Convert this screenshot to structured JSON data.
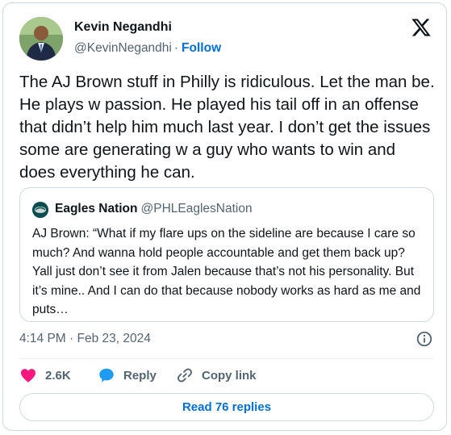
{
  "author": {
    "name": "Kevin Negandhi",
    "handle": "@KevinNegandhi",
    "separator": "·",
    "follow_label": "Follow"
  },
  "tweet": {
    "text": "The AJ Brown stuff in Philly is  ridiculous. Let the man be. He plays w passion. He played his tail off in an offense that didn’t help him much last year. I don’t get the issues some are generating w a guy who wants to win and does everything he can.",
    "timestamp": "4:14 PM · Feb 23, 2024"
  },
  "quote": {
    "name": "Eagles Nation",
    "handle": "@PHLEaglesNation",
    "text": "AJ Brown: “What if my flare ups on the sideline are because I care so much? And wanna hold people accountable and get them back up? Yall just don’t see it from Jalen because that’s not his personality. But it’s mine.. And I can do that because nobody works as hard as me and puts…"
  },
  "actions": {
    "likes": "2.6K",
    "reply_label": "Reply",
    "copy_link_label": "Copy link"
  },
  "read_replies_label": "Read 76 replies",
  "icons": [
    "x-logo-icon",
    "info-icon",
    "heart-icon",
    "reply-bubble-icon",
    "link-icon"
  ],
  "colors": {
    "link_blue": "#006fd6",
    "heart_pink": "#f91880",
    "reply_blue": "#1d9bf0",
    "muted": "#536471",
    "border": "#cfd9de"
  }
}
